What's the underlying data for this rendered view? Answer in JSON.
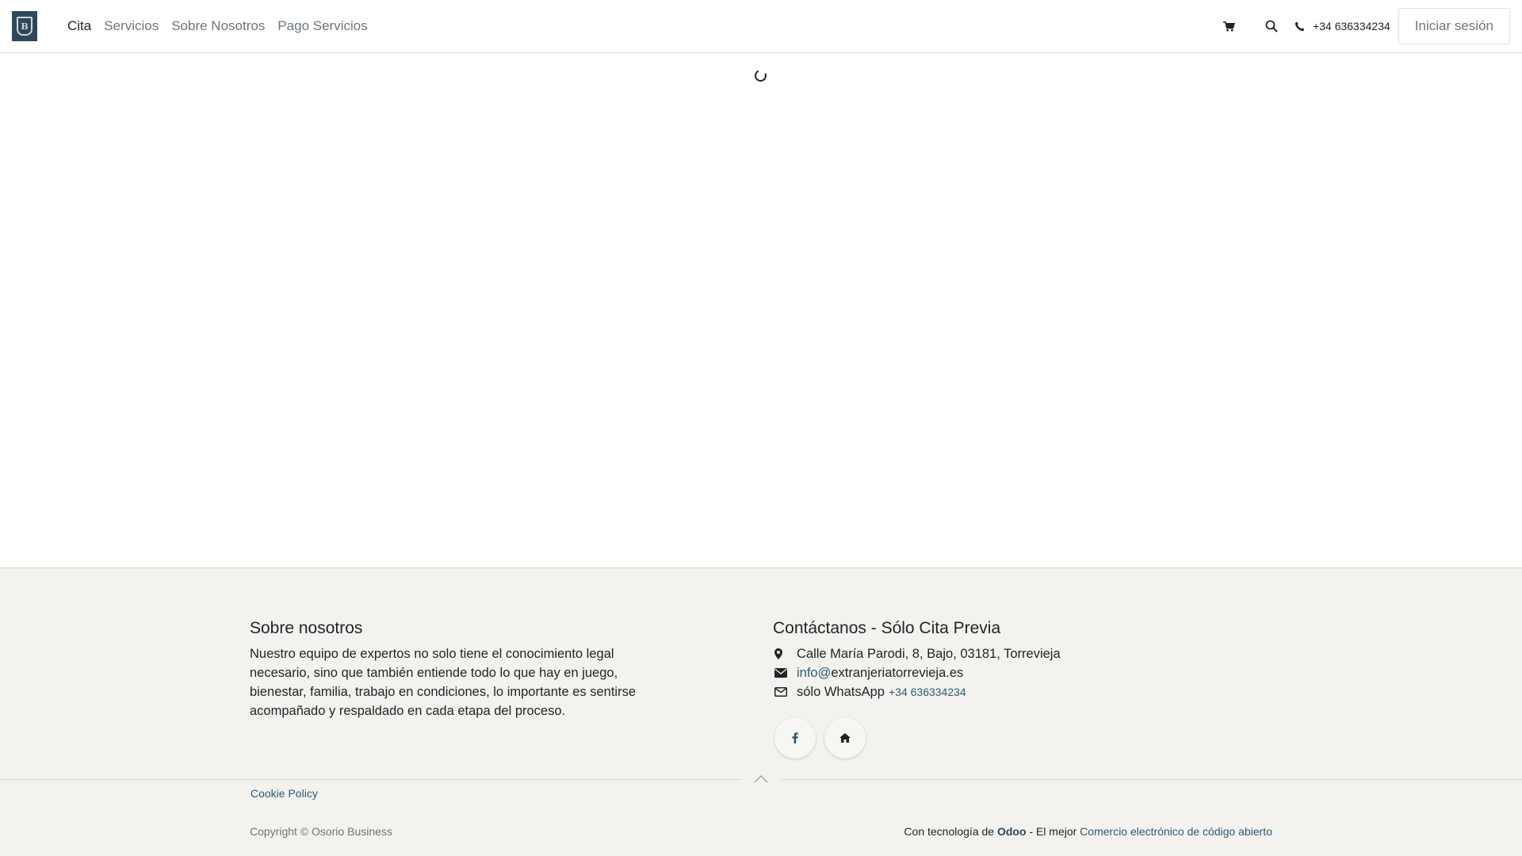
{
  "header": {
    "nav": [
      {
        "label": "Cita",
        "active": true
      },
      {
        "label": "Servicios",
        "active": false
      },
      {
        "label": "Sobre Nosotros",
        "active": false
      },
      {
        "label": "Pago Servicios",
        "active": false
      }
    ],
    "phone": "+34 636334234",
    "login_label": "Iniciar sesión",
    "icons": {
      "cart": "cart-icon",
      "search": "search-icon",
      "phone": "phone-icon"
    }
  },
  "footer": {
    "about": {
      "title": "Sobre nosotros",
      "text": "Nuestro equipo de expertos no solo tiene el conocimiento legal necesario, sino que también entiende todo lo que hay en juego, bienestar, familia, trabajo en condiciones, lo importante es sentirse acompañado y respaldado en cada etapa del proceso."
    },
    "contact": {
      "title": "Contáctanos - Sólo Cita Previa",
      "address": "Calle María Parodi, 8, Bajo, 03181, Torrevieja",
      "email_prefix": "info@",
      "email_domain": "extranjeriatorrevieja.es",
      "whatsapp_label": "sólo WhatsApp",
      "whatsapp_number": "+34 636334234"
    },
    "cookie": "Cookie Policy",
    "copyright": "Copyright © Osorio Business",
    "powered_prefix": "Con tecnología de",
    "powered_brand": "Odoo",
    "powered_mid": "- El mejor",
    "powered_link": "Comercio electrónico de código abierto"
  },
  "colors": {
    "accent": "#2e5a74",
    "footer_bg": "#f3f2ee",
    "logo_bg": "#2f4858"
  }
}
